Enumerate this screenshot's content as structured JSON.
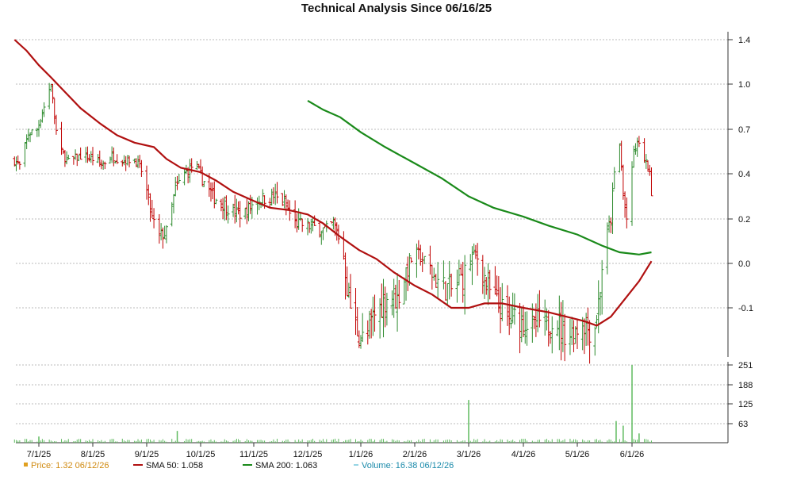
{
  "chart_data": {
    "title": "Technical Analysis Since 06/16/25",
    "type": "ohlc",
    "colors": {
      "up": "#2e8b2e",
      "down": "#c00000",
      "sma50": "#b01010",
      "sma200": "#1a8a1a",
      "volume": "#5fba5f",
      "grid": "#bbbbbb"
    },
    "x_tick_labels": [
      "7/1/25",
      "8/1/25",
      "9/1/25",
      "10/1/25",
      "11/1/25",
      "12/1/25",
      "1/1/26",
      "2/1/26",
      "3/1/26",
      "4/1/26",
      "5/1/26",
      "6/1/26"
    ],
    "price_axis": {
      "ticks": [
        "1.4",
        "1.0",
        "0.7",
        "0.4",
        "0.2",
        "0.0",
        "-0.1"
      ]
    },
    "volume_axis": {
      "ticks": [
        "251",
        "188",
        "125",
        "63"
      ]
    },
    "price_keypoints": [
      {
        "date": "2025-06-17",
        "close": 0.49
      },
      {
        "date": "2025-06-20",
        "close": 0.45
      },
      {
        "date": "2025-06-25",
        "close": 0.67
      },
      {
        "date": "2025-06-30",
        "close": 0.7
      },
      {
        "date": "2025-07-04",
        "close": 0.85
      },
      {
        "date": "2025-07-08",
        "close": 1.0
      },
      {
        "date": "2025-07-12",
        "close": 0.58
      },
      {
        "date": "2025-07-18",
        "close": 0.48
      },
      {
        "date": "2025-07-25",
        "close": 0.52
      },
      {
        "date": "2025-08-01",
        "close": 0.5
      },
      {
        "date": "2025-08-06",
        "close": 0.46
      },
      {
        "date": "2025-08-12",
        "close": 0.52
      },
      {
        "date": "2025-08-18",
        "close": 0.49
      },
      {
        "date": "2025-08-25",
        "close": 0.5
      },
      {
        "date": "2025-08-30",
        "close": 0.4
      },
      {
        "date": "2025-09-04",
        "close": 0.2
      },
      {
        "date": "2025-09-08",
        "close": 0.12
      },
      {
        "date": "2025-09-12",
        "close": 0.14
      },
      {
        "date": "2025-09-17",
        "close": 0.33
      },
      {
        "date": "2025-09-22",
        "close": 0.4
      },
      {
        "date": "2025-09-27",
        "close": 0.46
      },
      {
        "date": "2025-10-02",
        "close": 0.38
      },
      {
        "date": "2025-10-08",
        "close": 0.3
      },
      {
        "date": "2025-10-14",
        "close": 0.27
      },
      {
        "date": "2025-10-20",
        "close": 0.23
      },
      {
        "date": "2025-10-26",
        "close": 0.22
      },
      {
        "date": "2025-11-02",
        "close": 0.28
      },
      {
        "date": "2025-11-06",
        "close": 0.29
      },
      {
        "date": "2025-11-12",
        "close": 0.3
      },
      {
        "date": "2025-11-18",
        "close": 0.27
      },
      {
        "date": "2025-11-24",
        "close": 0.18
      },
      {
        "date": "2025-11-30",
        "close": 0.17
      },
      {
        "date": "2025-12-06",
        "close": 0.16
      },
      {
        "date": "2025-12-12",
        "close": 0.15
      },
      {
        "date": "2025-12-16",
        "close": 0.18
      },
      {
        "date": "2025-12-20",
        "close": 0.1
      },
      {
        "date": "2025-12-24",
        "close": -0.05
      },
      {
        "date": "2025-12-27",
        "close": -0.12
      },
      {
        "date": "2025-12-31",
        "close": -0.16
      },
      {
        "date": "2026-01-04",
        "close": -0.18
      },
      {
        "date": "2026-01-08",
        "close": -0.12
      },
      {
        "date": "2026-01-12",
        "close": -0.1
      },
      {
        "date": "2026-01-17",
        "close": -0.07
      },
      {
        "date": "2026-01-22",
        "close": -0.08
      },
      {
        "date": "2026-01-26",
        "close": -0.03
      },
      {
        "date": "2026-01-30",
        "close": 0.02
      },
      {
        "date": "2026-02-03",
        "close": 0.04
      },
      {
        "date": "2026-02-07",
        "close": 0.0
      },
      {
        "date": "2026-02-11",
        "close": -0.03
      },
      {
        "date": "2026-02-15",
        "close": -0.05
      },
      {
        "date": "2026-02-20",
        "close": -0.06
      },
      {
        "date": "2026-02-24",
        "close": -0.04
      },
      {
        "date": "2026-02-28",
        "close": -0.02
      },
      {
        "date": "2026-03-03",
        "close": 0.04
      },
      {
        "date": "2026-03-07",
        "close": 0.02
      },
      {
        "date": "2026-03-11",
        "close": -0.05
      },
      {
        "date": "2026-03-15",
        "close": -0.08
      },
      {
        "date": "2026-03-19",
        "close": -0.1
      },
      {
        "date": "2026-03-24",
        "close": -0.13
      },
      {
        "date": "2026-03-28",
        "close": -0.12
      },
      {
        "date": "2026-04-02",
        "close": -0.13
      },
      {
        "date": "2026-04-06",
        "close": -0.15
      },
      {
        "date": "2026-04-10",
        "close": -0.13
      },
      {
        "date": "2026-04-14",
        "close": -0.15
      },
      {
        "date": "2026-04-18",
        "close": -0.11
      },
      {
        "date": "2026-04-22",
        "close": -0.15
      },
      {
        "date": "2026-04-26",
        "close": -0.16
      },
      {
        "date": "2026-04-30",
        "close": -0.15
      },
      {
        "date": "2026-05-04",
        "close": -0.13
      },
      {
        "date": "2026-05-08",
        "close": -0.15
      },
      {
        "date": "2026-05-11",
        "close": -0.14
      },
      {
        "date": "2026-05-14",
        "close": -0.06
      },
      {
        "date": "2026-05-17",
        "close": 0.1
      },
      {
        "date": "2026-05-20",
        "close": 0.2
      },
      {
        "date": "2026-05-23",
        "close": 0.5
      },
      {
        "date": "2026-05-25",
        "close": 0.6
      },
      {
        "date": "2026-05-27",
        "close": 0.3
      },
      {
        "date": "2026-05-30",
        "close": 0.15
      },
      {
        "date": "2026-06-02",
        "close": 0.55
      },
      {
        "date": "2026-06-05",
        "close": 0.62
      },
      {
        "date": "2026-06-08",
        "close": 0.48
      },
      {
        "date": "2026-06-10",
        "close": 0.45
      },
      {
        "date": "2026-06-12",
        "close": 0.33
      }
    ],
    "sma50": [
      {
        "date": "2025-06-17",
        "value": 1.4
      },
      {
        "date": "2025-06-24",
        "value": 1.3
      },
      {
        "date": "2025-07-01",
        "value": 1.17
      },
      {
        "date": "2025-07-08",
        "value": 1.06
      },
      {
        "date": "2025-07-15",
        "value": 0.96
      },
      {
        "date": "2025-07-25",
        "value": 0.84
      },
      {
        "date": "2025-08-05",
        "value": 0.74
      },
      {
        "date": "2025-08-15",
        "value": 0.66
      },
      {
        "date": "2025-08-25",
        "value": 0.61
      },
      {
        "date": "2025-09-05",
        "value": 0.58
      },
      {
        "date": "2025-09-12",
        "value": 0.5
      },
      {
        "date": "2025-09-20",
        "value": 0.44
      },
      {
        "date": "2025-10-01",
        "value": 0.41
      },
      {
        "date": "2025-10-10",
        "value": 0.37
      },
      {
        "date": "2025-10-20",
        "value": 0.32
      },
      {
        "date": "2025-11-01",
        "value": 0.28
      },
      {
        "date": "2025-11-10",
        "value": 0.25
      },
      {
        "date": "2025-11-20",
        "value": 0.24
      },
      {
        "date": "2025-12-01",
        "value": 0.22
      },
      {
        "date": "2025-12-10",
        "value": 0.18
      },
      {
        "date": "2025-12-20",
        "value": 0.12
      },
      {
        "date": "2025-12-31",
        "value": 0.06
      },
      {
        "date": "2026-01-10",
        "value": 0.02
      },
      {
        "date": "2026-01-20",
        "value": -0.02
      },
      {
        "date": "2026-02-01",
        "value": -0.05
      },
      {
        "date": "2026-02-10",
        "value": -0.07
      },
      {
        "date": "2026-02-20",
        "value": -0.1
      },
      {
        "date": "2026-03-01",
        "value": -0.1
      },
      {
        "date": "2026-03-10",
        "value": -0.09
      },
      {
        "date": "2026-03-20",
        "value": -0.09
      },
      {
        "date": "2026-04-01",
        "value": -0.1
      },
      {
        "date": "2026-04-15",
        "value": -0.11
      },
      {
        "date": "2026-04-25",
        "value": -0.12
      },
      {
        "date": "2026-05-05",
        "value": -0.13
      },
      {
        "date": "2026-05-12",
        "value": -0.14
      },
      {
        "date": "2026-05-20",
        "value": -0.12
      },
      {
        "date": "2026-05-28",
        "value": -0.08
      },
      {
        "date": "2026-06-05",
        "value": -0.04
      },
      {
        "date": "2026-06-12",
        "value": 0.01
      }
    ],
    "sma200": [
      {
        "date": "2025-12-01",
        "value": 0.89
      },
      {
        "date": "2025-12-10",
        "value": 0.83
      },
      {
        "date": "2025-12-20",
        "value": 0.78
      },
      {
        "date": "2026-01-01",
        "value": 0.68
      },
      {
        "date": "2026-01-15",
        "value": 0.58
      },
      {
        "date": "2026-02-01",
        "value": 0.47
      },
      {
        "date": "2026-02-15",
        "value": 0.38
      },
      {
        "date": "2026-03-01",
        "value": 0.3
      },
      {
        "date": "2026-03-15",
        "value": 0.25
      },
      {
        "date": "2026-04-01",
        "value": 0.21
      },
      {
        "date": "2026-04-15",
        "value": 0.17
      },
      {
        "date": "2026-05-01",
        "value": 0.13
      },
      {
        "date": "2026-05-15",
        "value": 0.08
      },
      {
        "date": "2026-05-25",
        "value": 0.05
      },
      {
        "date": "2026-06-05",
        "value": 0.04
      },
      {
        "date": "2026-06-12",
        "value": 0.05
      }
    ],
    "volume_spikes": [
      {
        "date": "2026-03-01",
        "value": 138
      },
      {
        "date": "2026-05-23",
        "value": 70
      },
      {
        "date": "2026-05-27",
        "value": 55
      },
      {
        "date": "2026-06-01",
        "value": 251
      },
      {
        "date": "2026-06-05",
        "value": 30
      },
      {
        "date": "2025-09-18",
        "value": 38
      },
      {
        "date": "2025-07-01",
        "value": 20
      }
    ],
    "legend": [
      {
        "key": "price",
        "label": "Price: 1.32",
        "date": "06/12/26",
        "color": "#e0a020",
        "text_color": "#d08a10"
      },
      {
        "key": "sma50",
        "label": "SMA 50: 1.058",
        "date": "",
        "color": "#b01010",
        "text_color": "#111111"
      },
      {
        "key": "sma200",
        "label": "SMA 200: 1.063",
        "date": "",
        "color": "#1a8a1a",
        "text_color": "#111111"
      },
      {
        "key": "volume",
        "label": "Volume: 16.38",
        "date": "06/12/26",
        "color": "#2ba8c9",
        "text_color": "#1a8aaa"
      }
    ]
  }
}
